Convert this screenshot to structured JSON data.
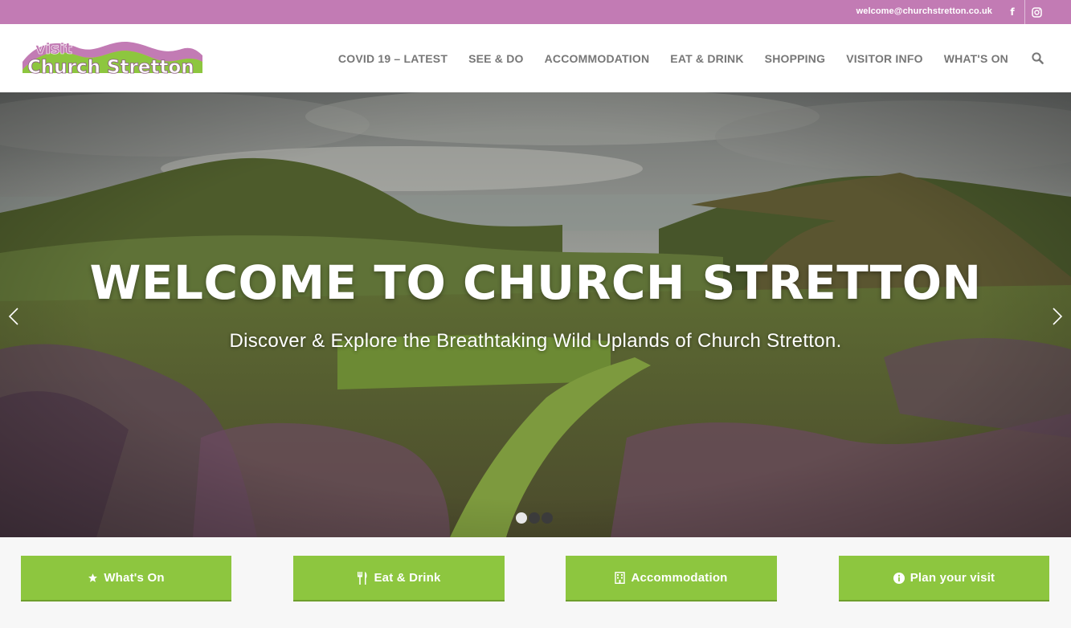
{
  "topbar": {
    "email": "welcome@churchstretton.co.uk",
    "facebook_glyph": "f",
    "social_icons": [
      "facebook-icon",
      "instagram-icon"
    ],
    "background": "#c27bb4"
  },
  "logo": {
    "line1": "visit",
    "line2": "Church Stretton"
  },
  "nav": {
    "items": [
      "COVID 19 – LATEST",
      "SEE & DO",
      "ACCOMMODATION",
      "EAT & DRINK",
      "SHOPPING",
      "VISITOR INFO",
      "WHAT'S ON"
    ],
    "search_icon": "search-icon"
  },
  "hero": {
    "title": "WELCOME TO CHURCH STRETTON",
    "subtitle": "Discover & Explore the Breathtaking Wild Uplands of Church Stretton.",
    "slides_count": 3,
    "active_slide": 1
  },
  "cta_buttons": [
    {
      "label": "What's On",
      "icon": "star-icon"
    },
    {
      "label": "Eat & Drink",
      "icon": "cutlery-icon"
    },
    {
      "label": "Accommodation",
      "icon": "building-icon"
    },
    {
      "label": "Plan your visit",
      "icon": "info-icon"
    }
  ],
  "colors": {
    "accent_green": "#8dc63f",
    "brand_purple": "#c27bb4"
  }
}
